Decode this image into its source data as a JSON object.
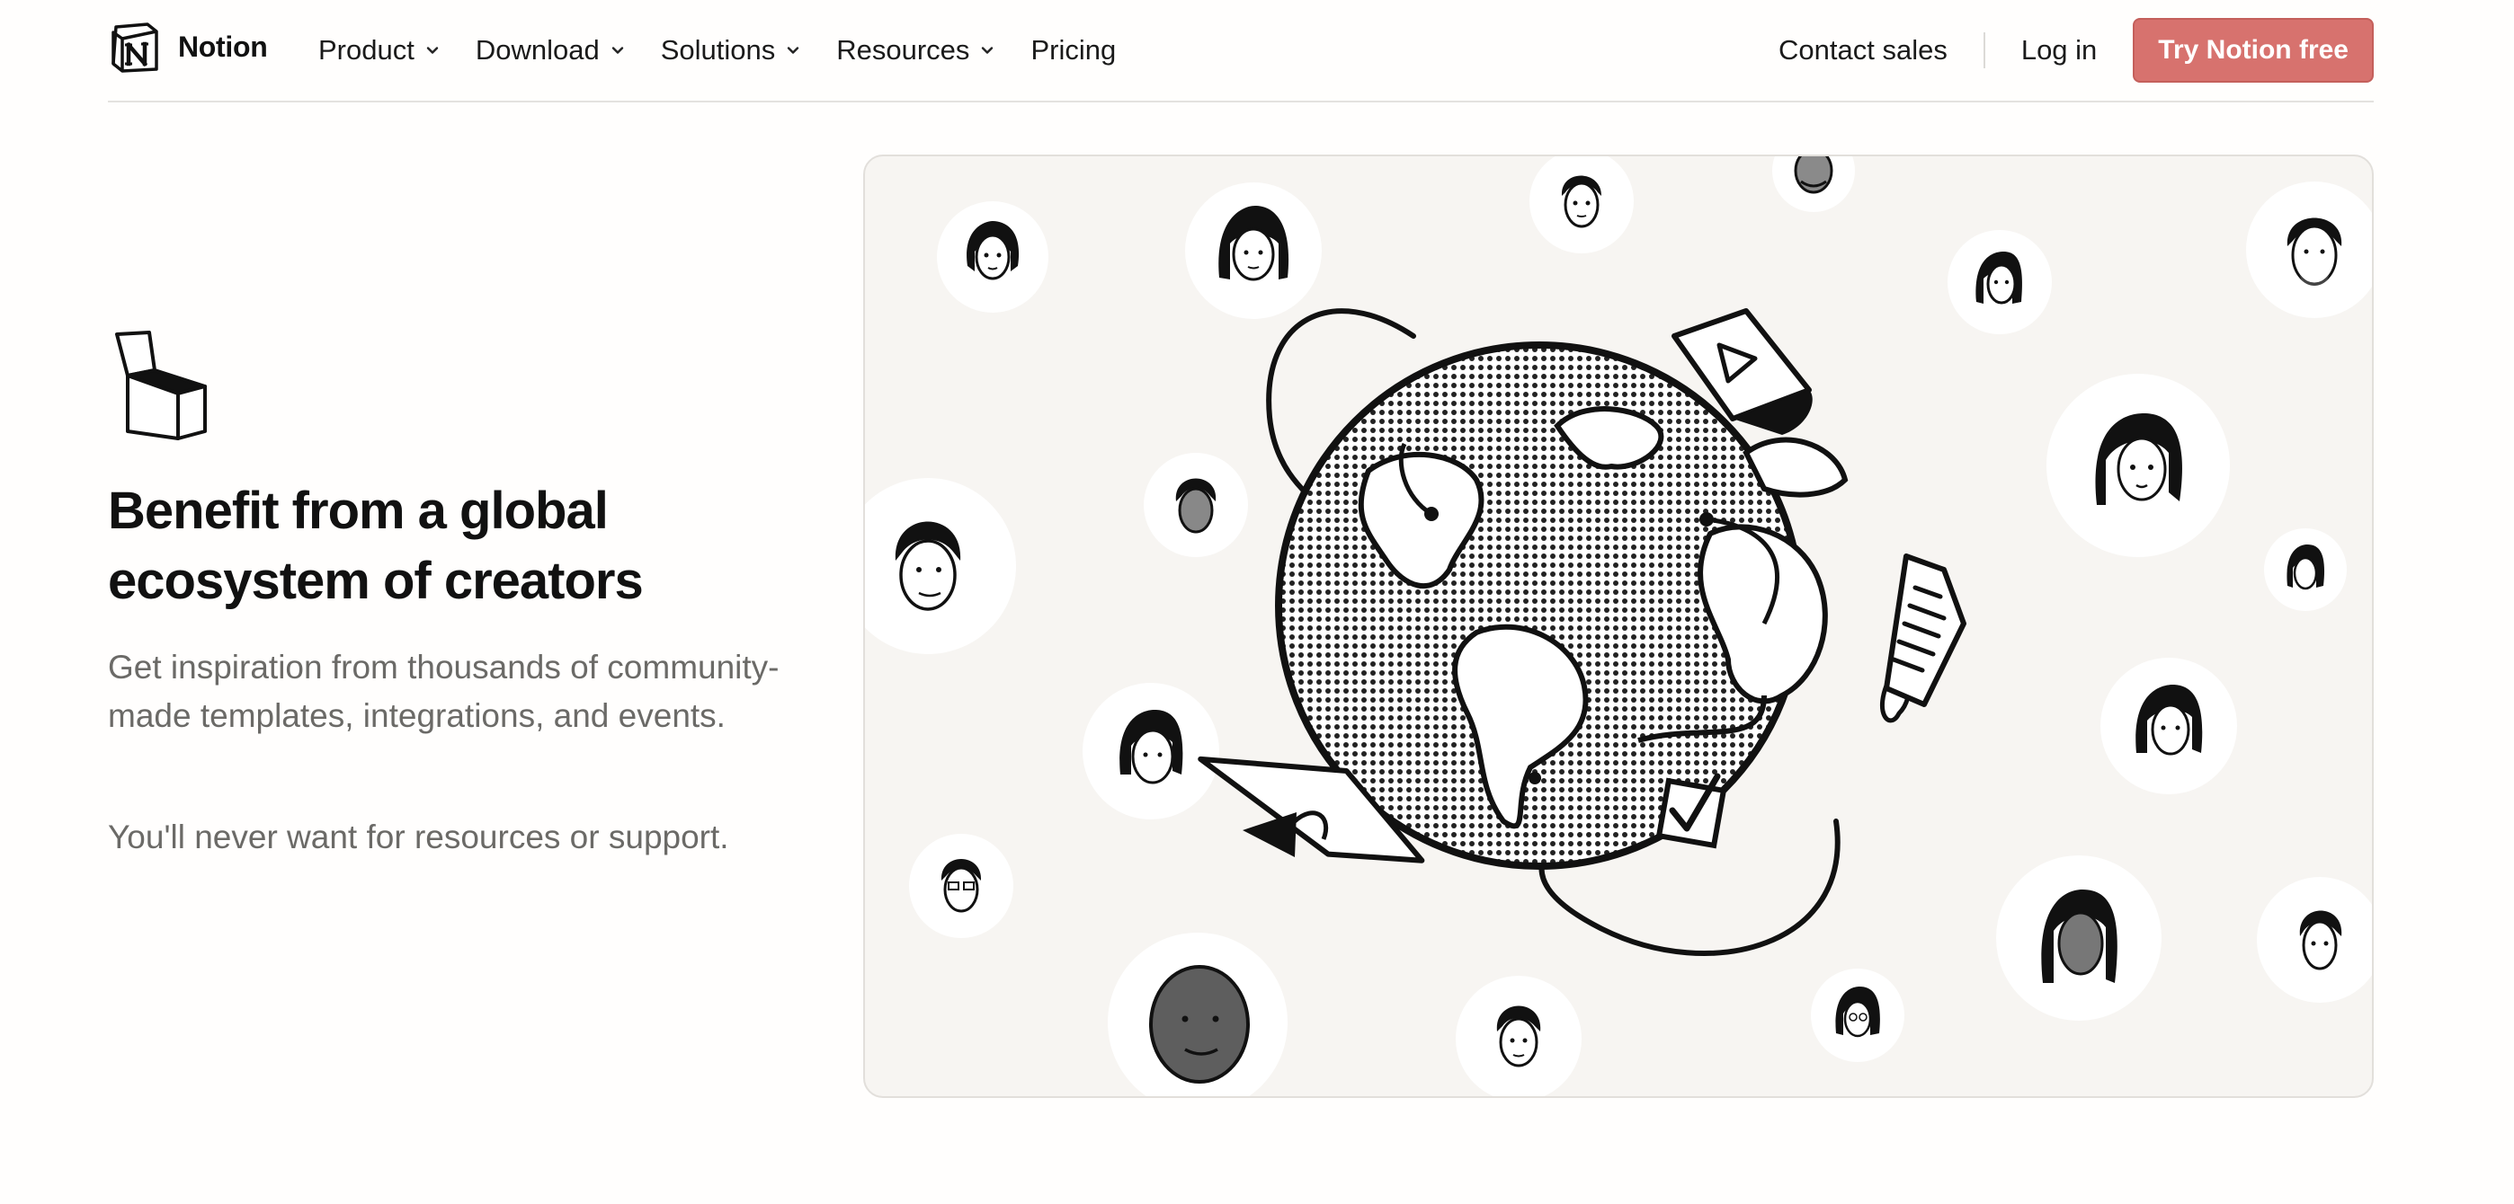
{
  "header": {
    "brand": "Notion",
    "nav": [
      {
        "label": "Product",
        "has_dropdown": true
      },
      {
        "label": "Download",
        "has_dropdown": true
      },
      {
        "label": "Solutions",
        "has_dropdown": true
      },
      {
        "label": "Resources",
        "has_dropdown": true
      },
      {
        "label": "Pricing",
        "has_dropdown": false
      }
    ],
    "contact_sales": "Contact sales",
    "log_in": "Log in",
    "cta": "Try Notion free"
  },
  "hero": {
    "icon": "open-box-icon",
    "headline": "Benefit from a global ecosystem of creators",
    "body": "Get inspiration from thousands of community-made templates, integrations, and events.",
    "body_2": "You'll never want for resources or support."
  },
  "illustration": {
    "icon": "globe-with-community-avatars-illustration"
  },
  "colors": {
    "cta_background": "#d7726e",
    "page_background": "#fffefd",
    "panel_background": "#f7f5f2",
    "body_text": "#6b6a67"
  }
}
